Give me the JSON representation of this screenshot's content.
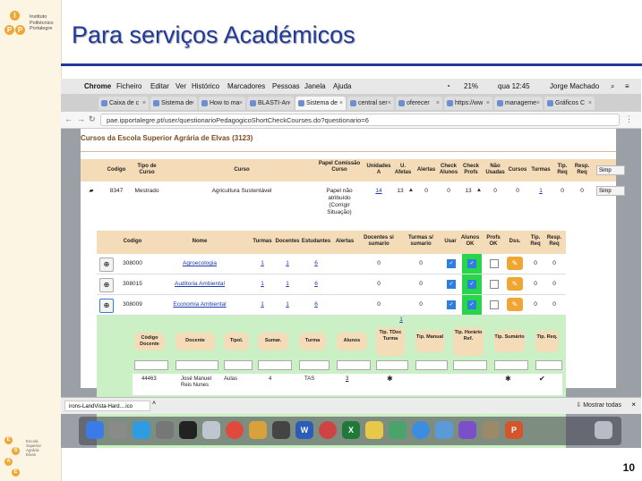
{
  "slide": {
    "title": "Para serviços Académicos",
    "page_number": "10",
    "logo_top_lines": [
      "Instituto",
      "Politécnico",
      "Portalegre"
    ],
    "logo_top_letters": [
      "I",
      "P",
      "P"
    ],
    "logo_bottom_letters": [
      "E",
      "S",
      "A",
      "E"
    ],
    "logo_bottom_lines": [
      "Escola",
      "Superior",
      "Agrária",
      "Elvas"
    ]
  },
  "mac_menu": {
    "app": "Chrome",
    "items": [
      "Ficheiro",
      "Editar",
      "Ver",
      "Histórico",
      "Marcadores",
      "Pessoas",
      "Janela",
      "Ajuda"
    ],
    "status": [
      "21%",
      "qua 12:45",
      "Jorge Machado"
    ]
  },
  "tabs": [
    {
      "label": "Caixa de c"
    },
    {
      "label": "Sistema de"
    },
    {
      "label": "How to ma"
    },
    {
      "label": "BLASTI-An"
    },
    {
      "label": "Sistema de",
      "active": true
    },
    {
      "label": "central ser"
    },
    {
      "label": "oferecer"
    },
    {
      "label": "https://ww"
    },
    {
      "label": "manageme"
    },
    {
      "label": "Gráficos C"
    }
  ],
  "address": "pae.ipportalegre.pt/user/questionarioPedagogicoShortCheckCourses.do?questionario=6",
  "main": {
    "section_title": "Cursos da Escola Superior Agrária de Elvas (3123)",
    "headers": [
      "Codigo",
      "Tipo de Curso",
      "Curso",
      "Papel Comissão Curso",
      "Unidades A",
      "U. Afetas",
      "Alertas",
      "Check Alunos",
      "Check Profs",
      "Não Usadas",
      "Cursos",
      "Turmas",
      "Tip. Req",
      "Resp. Req"
    ],
    "row": {
      "codigo": "8347",
      "tipo": "Mestrado",
      "curso": "Agricultura Sustentável",
      "papel": [
        "Papel não",
        "atribuído",
        "(Corrigir",
        "Situação)"
      ],
      "unidades": "14",
      "afetas": "13",
      "alertas": "0",
      "check_alunos": "0",
      "check_profs": "13",
      "nao_usadas": "0",
      "cursos": "0",
      "turmas": "1",
      "tip_req": "0",
      "resp_req": "0"
    },
    "simp_labels": [
      "Simp",
      "Simp"
    ]
  },
  "inner": {
    "headers": [
      "Codigo",
      "Nome",
      "Turmas",
      "Docentes",
      "Estudantes",
      "Alertas",
      "Docentes si sumario",
      "Turmas s/ sumario",
      "Usar",
      "Alunos OK",
      "Profs OK",
      "Dss.",
      "Tip. Req",
      "Resp. Req"
    ],
    "rows": [
      {
        "codigo": "308000",
        "nome": "Agroecologia",
        "turmas": "1",
        "docentes": "1",
        "estudantes": "6",
        "ds": "0",
        "ts": "0",
        "tip": "0",
        "resp": "0"
      },
      {
        "codigo": "308015",
        "nome": "Auditoria Ambiental",
        "turmas": "1",
        "docentes": "1",
        "estudantes": "6",
        "ds": "0",
        "ts": "0",
        "tip": "0",
        "resp": "0"
      },
      {
        "codigo": "308009",
        "nome": "Economia Ambiental",
        "turmas": "1",
        "docentes": "1",
        "estudantes": "6",
        "ds": "0",
        "ts": "0",
        "tip": "0",
        "resp": "0"
      }
    ],
    "pager": "1",
    "nested_headers": [
      "Código Docente",
      "Docente",
      "Tipol.",
      "Sumar.",
      "Turma",
      "Alunos",
      "Tip. TDoc Turma",
      "Tip. Manual",
      "Tip. Horário Ref.",
      "Tip. Sumário",
      "Tip. Req."
    ],
    "nested_row": {
      "codigo": "44463",
      "docente": [
        "José Manuel",
        "Reis Nunes"
      ],
      "tipol": "Aulas",
      "sumar": "4",
      "turma": "TAS",
      "alunos": "3"
    }
  },
  "bottom": {
    "download": "irons-LandVista-Hard....ico",
    "show_all": "Mostrar todas"
  },
  "dock_icons": [
    "finder-icon",
    "launchpad-icon",
    "browser-icon",
    "settings-icon",
    "terminal-icon",
    "preview-icon",
    "chrome-icon",
    "photos-icon",
    "activity-icon",
    "word-icon",
    "color-icon",
    "excel-icon",
    "notes-icon",
    "maps-icon",
    "safari-icon",
    "mail-icon",
    "app-icon",
    "tool-icon",
    "powerpoint-icon",
    "trash-icon"
  ]
}
